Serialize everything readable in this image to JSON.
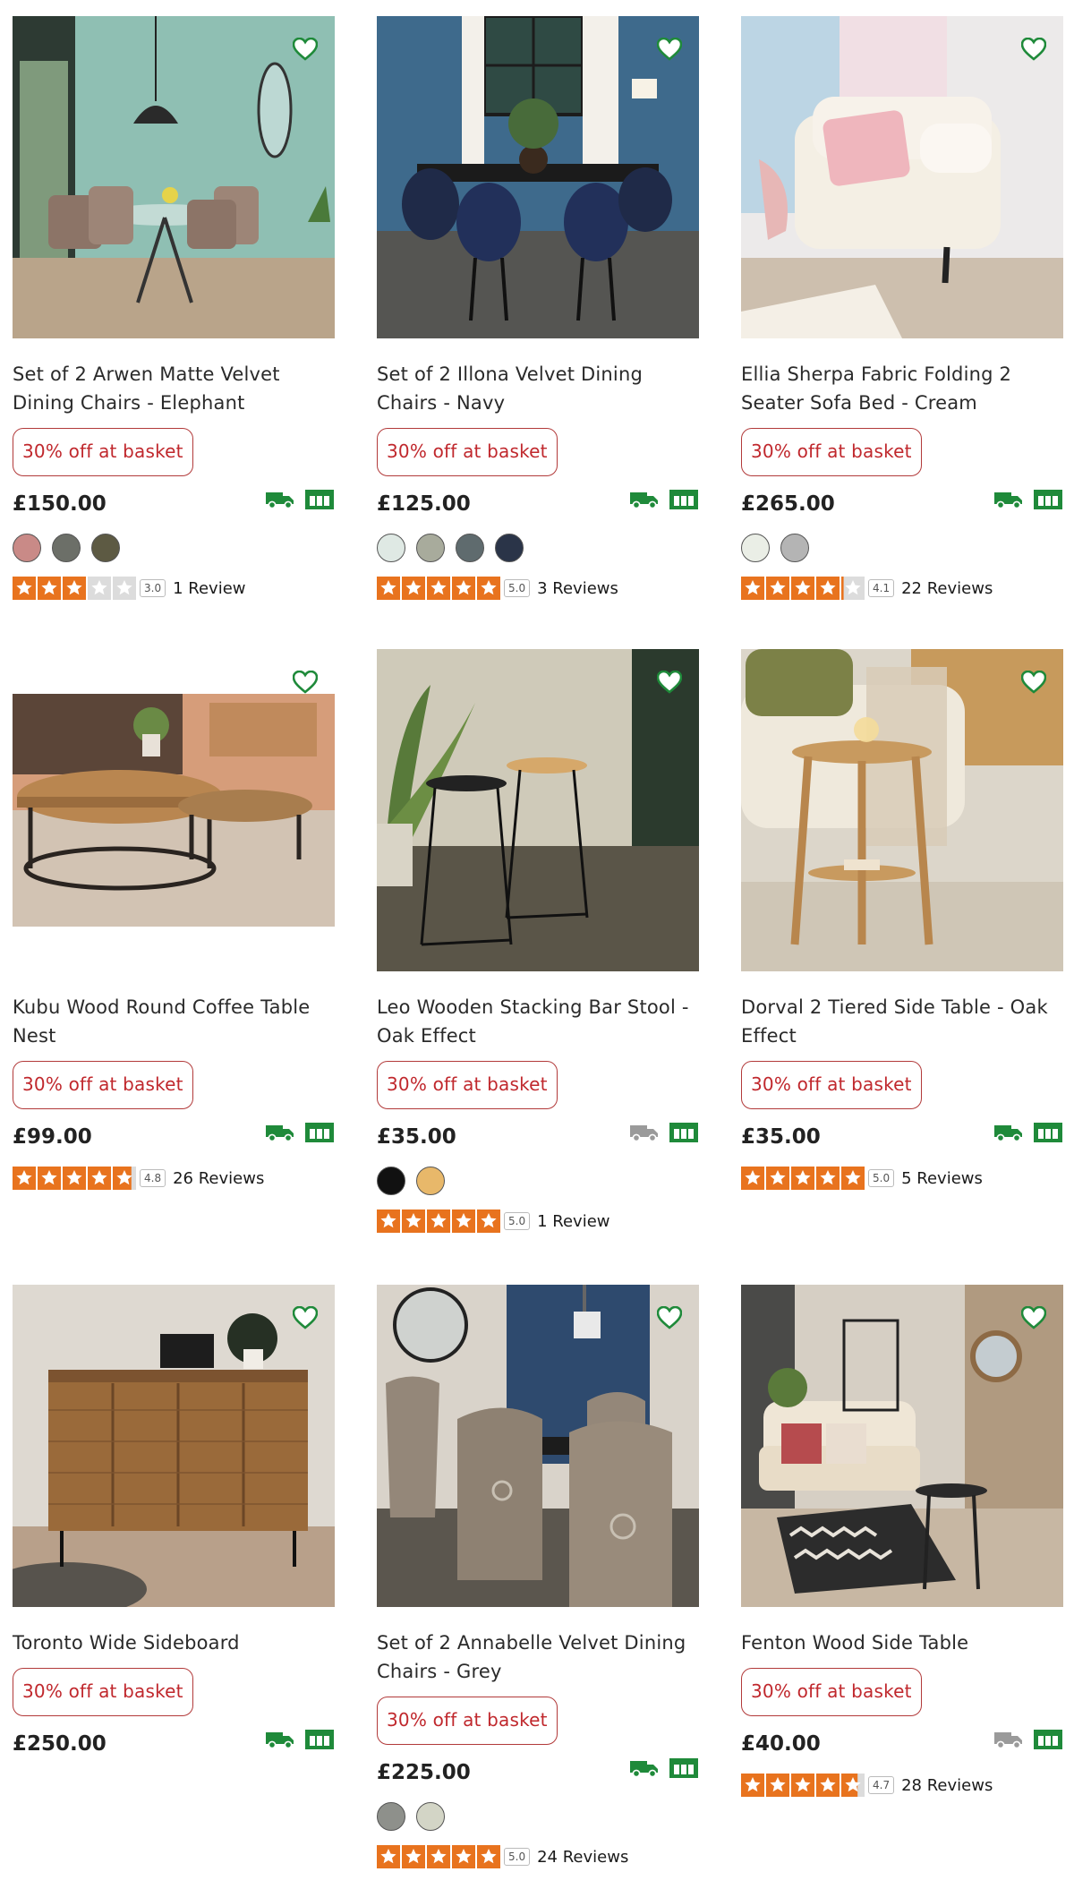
{
  "products": [
    {
      "title": "Set of 2 Arwen Matte Velvet Dining Chairs - Elephant",
      "promo": "30% off at basket",
      "price": "£150.00",
      "delivery_available": true,
      "swatches": [
        "#c98a87",
        "#6c6f68",
        "#5d5a43"
      ],
      "rating": 3.0,
      "rating_label": "3.0",
      "reviews": "1 Review"
    },
    {
      "title": "Set of 2 Illona Velvet Dining Chairs - Navy",
      "promo": "30% off at basket",
      "price": "£125.00",
      "delivery_available": true,
      "swatches": [
        "#dfe9e4",
        "#a8ab9c",
        "#5f6b6e",
        "#2a3448"
      ],
      "rating": 5.0,
      "rating_label": "5.0",
      "reviews": "3 Reviews"
    },
    {
      "title": "Ellia Sherpa Fabric Folding 2 Seater Sofa Bed - Cream",
      "promo": "30% off at basket",
      "price": "£265.00",
      "delivery_available": true,
      "swatches": [
        "#eaeee6",
        "#b4b4b4"
      ],
      "rating": 4.1,
      "rating_label": "4.1",
      "reviews": "22 Reviews"
    },
    {
      "title": "Kubu Wood Round Coffee Table Nest",
      "promo": "30% off at basket",
      "price": "£99.00",
      "delivery_available": true,
      "swatches": [],
      "rating": 4.8,
      "rating_label": "4.8",
      "reviews": "26 Reviews"
    },
    {
      "title": "Leo Wooden Stacking Bar Stool - Oak Effect",
      "promo": "30% off at basket",
      "price": "£35.00",
      "delivery_available": false,
      "swatches": [
        "#111111",
        "#e8b86a"
      ],
      "rating": 5.0,
      "rating_label": "5.0",
      "reviews": "1 Review"
    },
    {
      "title": "Dorval 2 Tiered Side Table - Oak Effect",
      "promo": "30% off at basket",
      "price": "£35.00",
      "delivery_available": true,
      "swatches": [],
      "rating": 5.0,
      "rating_label": "5.0",
      "reviews": "5 Reviews"
    },
    {
      "title": "Toronto Wide Sideboard",
      "promo": "30% off at basket",
      "price": "£250.00",
      "delivery_available": true,
      "swatches": [],
      "rating": null,
      "rating_label": "",
      "reviews": ""
    },
    {
      "title": "Set of 2 Annabelle Velvet Dining Chairs - Grey",
      "promo": "30% off at basket",
      "price": "£225.00",
      "delivery_available": true,
      "swatches": [
        "#8e908b",
        "#d3d5c6"
      ],
      "rating": 5.0,
      "rating_label": "5.0",
      "reviews": "24 Reviews"
    },
    {
      "title": "Fenton Wood Side Table",
      "promo": "30% off at basket",
      "price": "£40.00",
      "delivery_available": false,
      "swatches": [],
      "rating": 4.7,
      "rating_label": "4.7",
      "reviews": "28 Reviews"
    }
  ],
  "colors": {
    "accent_green": "#1f8a3a",
    "promo_red": "#c0282d",
    "star_orange": "#e8731e",
    "star_empty": "#dcdcdc",
    "delivery_unavailable": "#9a9a9a"
  },
  "icons": {
    "favourite": "heart-outline-icon",
    "delivery": "delivery-van-icon",
    "collection": "click-and-collect-store-icon",
    "star": "star-icon"
  }
}
